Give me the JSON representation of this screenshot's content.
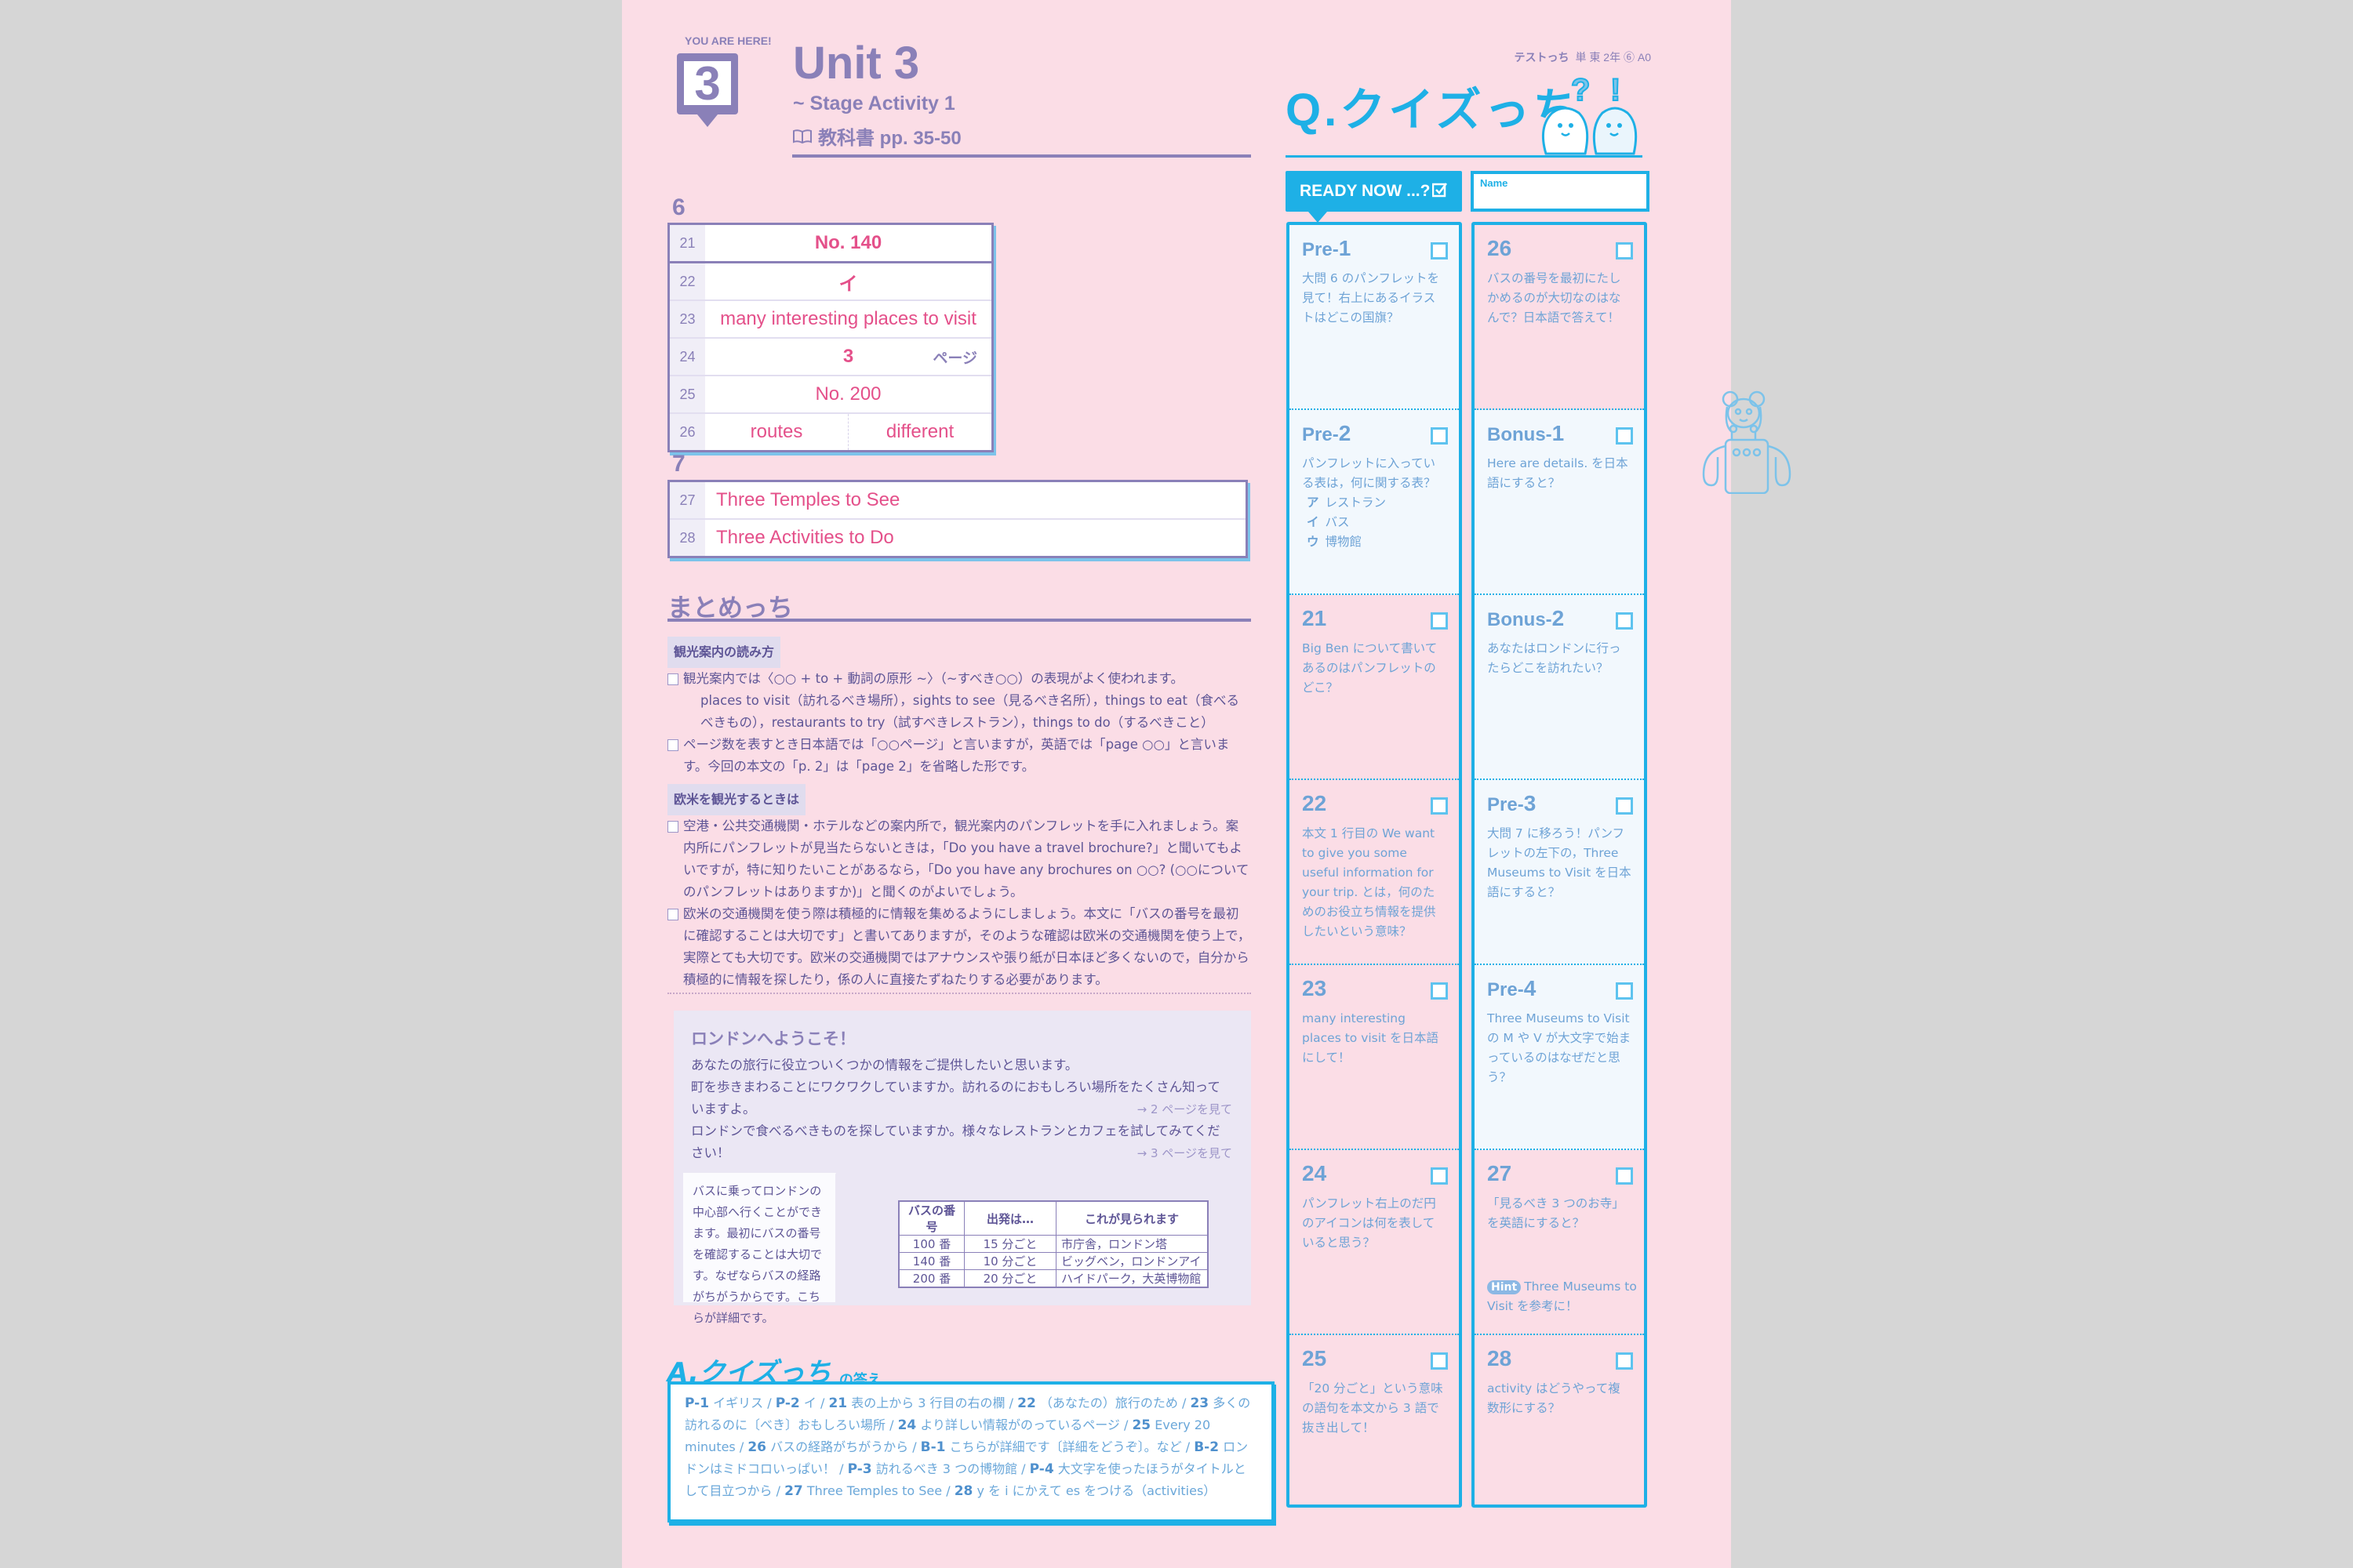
{
  "header": {
    "you_are_here": "YOU ARE HERE!",
    "unit_number": "3",
    "unit_title": "Unit 3",
    "unit_subtitle": "~ Stage Activity 1",
    "textbook_ref": "教科書 pp. 35-50",
    "meta_brand": "テストっち",
    "meta_info": "単 東 2年 ⑥ A0"
  },
  "section6": {
    "number": "6",
    "rows": [
      {
        "num": "21",
        "value": "No. 140"
      },
      {
        "num": "22",
        "value": "イ"
      },
      {
        "num": "23",
        "value": "many interesting places to visit"
      },
      {
        "num": "24",
        "value": "3",
        "suffix": "ページ"
      },
      {
        "num": "25",
        "value": "No. 200"
      },
      {
        "num": "26",
        "values": [
          "routes",
          "different"
        ]
      }
    ]
  },
  "section7": {
    "number": "7",
    "rows": [
      {
        "num": "27",
        "value": "Three Temples to See"
      },
      {
        "num": "28",
        "value": "Three Activities to Do"
      }
    ]
  },
  "matome": {
    "title": "まとめっち",
    "block1": {
      "tag": "観光案内の読み方",
      "item1": "観光案内では〈○○ + to + 動詞の原形 ~〉（~すべき○○）の表現がよく使われます。",
      "item1_sub": "places to visit（訪れるべき場所），sights to see（見るべき名所），things to eat（食べるべきもの），restaurants to try（試すべきレストラン），things to do（するべきこと）",
      "item2": "ページ数を表すとき日本語では「○○ページ」と言いますが，英語では「page ○○」と言います。今回の本文の「p. 2」は「page 2」を省略した形です。"
    },
    "block2": {
      "tag": "欧米を観光するときは",
      "item1": "空港・公共交通機関・ホテルなどの案内所で，観光案内のパンフレットを手に入れましょう。案内所にパンフレットが見当たらないときは，「Do you have a travel brochure?」と聞いてもよいですが，特に知りたいことがあるなら，「Do you have any brochures on ○○? (○○についてのパンフレットはありますか)」と聞くのがよいでしょう。",
      "item2": "欧米の交通機関を使う際は積極的に情報を集めるようにしましょう。本文に「バスの番号を最初に確認することは大切です」と書いてありますが，そのような確認は欧米の交通機関を使う上で，実際とても大切です。欧米の交通機関ではアナウンスや張り紙が日本ほど多くないので，自分から積極的に情報を探したり，係の人に直接たずねたりする必要があります。"
    }
  },
  "london": {
    "title": "ロンドンへようこそ！",
    "line1": "あなたの旅行に役立ついくつかの情報をご提供したいと思います。",
    "line2": "町を歩きまわることにワクワクしていますか。訪れるのにおもしろい場所をたくさん知っていますよ。",
    "ref1": "→ 2 ページを見て",
    "line3": "ロンドンで食べるべきものを探していますか。様々なレストランとカフェを試してみてください！",
    "ref2": "→ 3 ページを見て",
    "bubble": "バスに乗ってロンドンの中心部へ行くことができます。最初にバスの番号を確認することは大切です。なぜならバスの経路がちがうからです。こちらが詳細です。",
    "bus_table": {
      "headers": [
        "バスの番号",
        "出発は…",
        "これが見られます"
      ],
      "rows": [
        [
          "100 番",
          "15 分ごと",
          "市庁舎，ロンドン塔"
        ],
        [
          "140 番",
          "10 分ごと",
          "ビッグベン，ロンドンアイ"
        ],
        [
          "200 番",
          "20 分ごと",
          "ハイドパーク，大英博物館"
        ]
      ]
    }
  },
  "answers": {
    "title": "A.クイズっち",
    "title_suffix": "の答え",
    "items": [
      {
        "k": "P-1",
        "v": "イギリス"
      },
      {
        "k": "P-2",
        "v": "イ"
      },
      {
        "k": "21",
        "v": "表の上から 3 行目の右の欄"
      },
      {
        "k": "22",
        "v": "（あなたの）旅行のため"
      },
      {
        "k": "23",
        "v": "多くの訪れるのに〔べき〕おもしろい場所"
      },
      {
        "k": "24",
        "v": "より詳しい情報がのっているページ"
      },
      {
        "k": "25",
        "v": "Every 20 minutes"
      },
      {
        "k": "26",
        "v": "バスの経路がちがうから"
      },
      {
        "k": "B-1",
        "v": "こちらが詳細です〔詳細をどうぞ〕。など"
      },
      {
        "k": "B-2",
        "v": "ロンドンはミドコロいっぱい！"
      },
      {
        "k": "P-3",
        "v": "訪れるべき 3 つの博物館"
      },
      {
        "k": "P-4",
        "v": "大文字を使ったほうがタイトルとして目立つから"
      },
      {
        "k": "27",
        "v": "Three Temples to See"
      },
      {
        "k": "28",
        "v": "y を i にかえて es をつける（activities）"
      }
    ]
  },
  "quiz": {
    "title": "Q.クイズっち",
    "ready_label": "READY NOW ...?",
    "name_label": "Name",
    "col1": [
      {
        "pre": "Pre-",
        "num": "1",
        "text": "大問 6 のパンフレットを見て！右上にあるイラストはどこの国旗？",
        "tint": true
      },
      {
        "pre": "Pre-",
        "num": "2",
        "text": "パンフレットに入っている表は，何に関する表？",
        "options": [
          [
            "ア",
            "レストラン"
          ],
          [
            "イ",
            "バス"
          ],
          [
            "ウ",
            "博物館"
          ]
        ],
        "tint": true
      },
      {
        "pre": "",
        "num": "21",
        "text": "Big Ben について書いてあるのはパンフレットのどこ？"
      },
      {
        "pre": "",
        "num": "22",
        "text": "本文 1 行目の We want to give you some useful information for your trip. とは，何のためのお役立ち情報を提供したいという意味？"
      },
      {
        "pre": "",
        "num": "23",
        "text": "many interesting places to visit を日本語にして！"
      },
      {
        "pre": "",
        "num": "24",
        "text": "パンフレット右上のだ円のアイコンは何を表していると思う？"
      },
      {
        "pre": "",
        "num": "25",
        "text": "「20 分ごと」という意味の語句を本文から 3 語で抜き出して！"
      }
    ],
    "col2": [
      {
        "pre": "",
        "num": "26",
        "text": "バスの番号を最初にたしかめるのが大切なのはなんで？日本語で答えて！"
      },
      {
        "pre": "Bonus-",
        "num": "1",
        "text": "Here are details. を日本語にすると？",
        "tint": true
      },
      {
        "pre": "Bonus-",
        "num": "2",
        "text": "あなたはロンドンに行ったらどこを訪れたい？",
        "tint": true
      },
      {
        "pre": "Pre-",
        "num": "3",
        "text": "大問 7 に移ろう！パンフレットの左下の，Three Museums to Visit を日本語にすると？",
        "tint": true
      },
      {
        "pre": "Pre-",
        "num": "4",
        "text": "Three Museums to Visit の M や V が大文字で始まっているのはなぜだと思う？",
        "tint": true
      },
      {
        "pre": "",
        "num": "27",
        "text": "「見るべき 3 つのお寺」を英語にすると？",
        "hint_label": "Hint",
        "hint": "Three Museums to Visit を参考に！"
      },
      {
        "pre": "",
        "num": "28",
        "text": "activity はどうやって複数形にする？"
      }
    ]
  },
  "colors": {
    "page_bg": "#fbdde6",
    "purple": "#8a80b8",
    "answer_pink": "#e4508a",
    "quiz_blue": "#1eb0e6"
  }
}
